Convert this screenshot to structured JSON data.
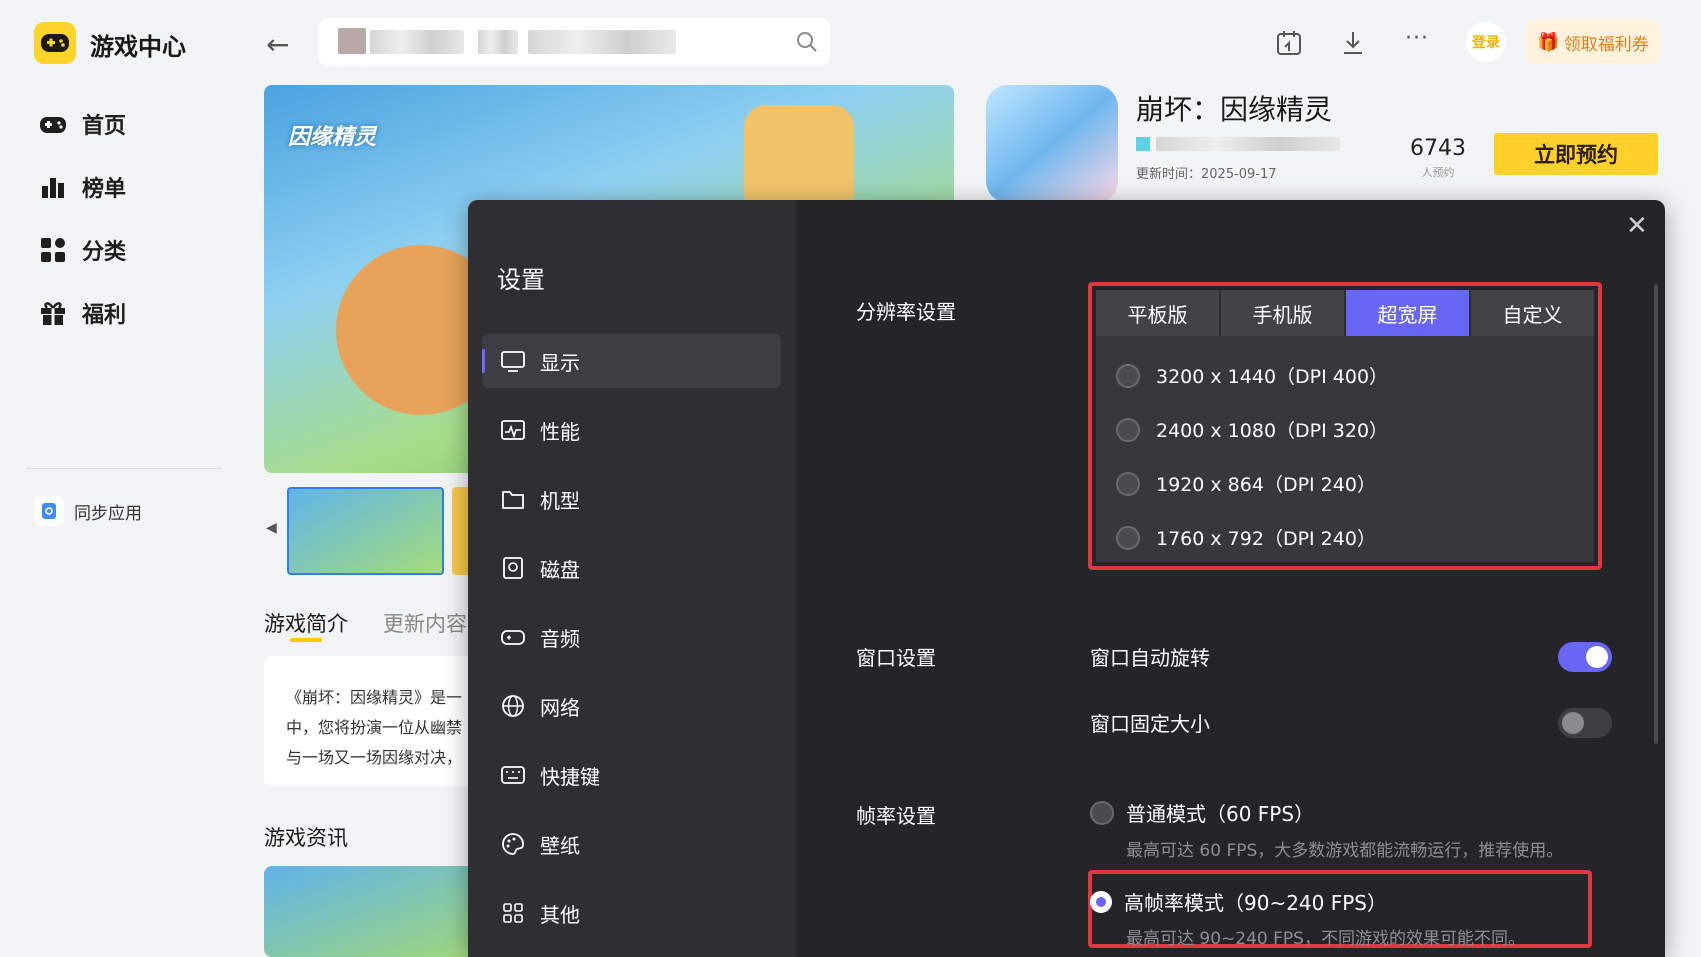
{
  "app": {
    "title": "游戏中心"
  },
  "nav": {
    "items": [
      {
        "label": "首页",
        "icon": "gamepad-icon"
      },
      {
        "label": "榜单",
        "icon": "bar-chart-icon"
      },
      {
        "label": "分类",
        "icon": "grid-icon"
      },
      {
        "label": "福利",
        "icon": "gift-icon"
      }
    ],
    "sync_label": "同步应用"
  },
  "topbar": {
    "login_label": "登录",
    "coupon_label": "领取福利券"
  },
  "game": {
    "name": "崩坏：因缘精灵",
    "update_time": "更新时间：2025-09-17",
    "reservations": "6743",
    "reservations_unit": "人预约",
    "reserve_button": "立即预约",
    "banner_logo": "因缘精灵",
    "tabs": [
      "游戏简介",
      "更新内容"
    ],
    "intro_lines": [
      "《崩坏：因缘精灵》是一",
      "中，您将扮演一位从幽禁",
      "与一场又一场因缘对决，"
    ],
    "news_title": "游戏资讯"
  },
  "settings": {
    "title": "设置",
    "menu": [
      "显示",
      "性能",
      "机型",
      "磁盘",
      "音频",
      "网络",
      "快捷键",
      "壁纸",
      "其他"
    ],
    "active_menu": "显示",
    "resolution": {
      "label": "分辨率设置",
      "tabs": [
        "平板版",
        "手机版",
        "超宽屏",
        "自定义"
      ],
      "active_tab": "超宽屏",
      "options": [
        "3200 x 1440（DPI 400）",
        "2400 x 1080（DPI 320）",
        "1920 x 864（DPI 240）",
        "1760 x 792（DPI 240）"
      ]
    },
    "window": {
      "label": "窗口设置",
      "auto_rotate": {
        "label": "窗口自动旋转",
        "on": true
      },
      "fixed_size": {
        "label": "窗口固定大小",
        "on": false
      }
    },
    "fps": {
      "label": "帧率设置",
      "normal": {
        "label": "普通模式（60 FPS）",
        "desc": "最高可达 60 FPS，大多数游戏都能流畅运行，推荐使用。",
        "selected": false
      },
      "high": {
        "label": "高帧率模式（90~240 FPS）",
        "desc": "最高可达 90~240 FPS，不同游戏的效果可能不同。",
        "selected": true
      }
    }
  },
  "colors": {
    "accent": "#6766f5",
    "highlight_border": "#e13740",
    "brand_yellow": "#ffd02a"
  }
}
